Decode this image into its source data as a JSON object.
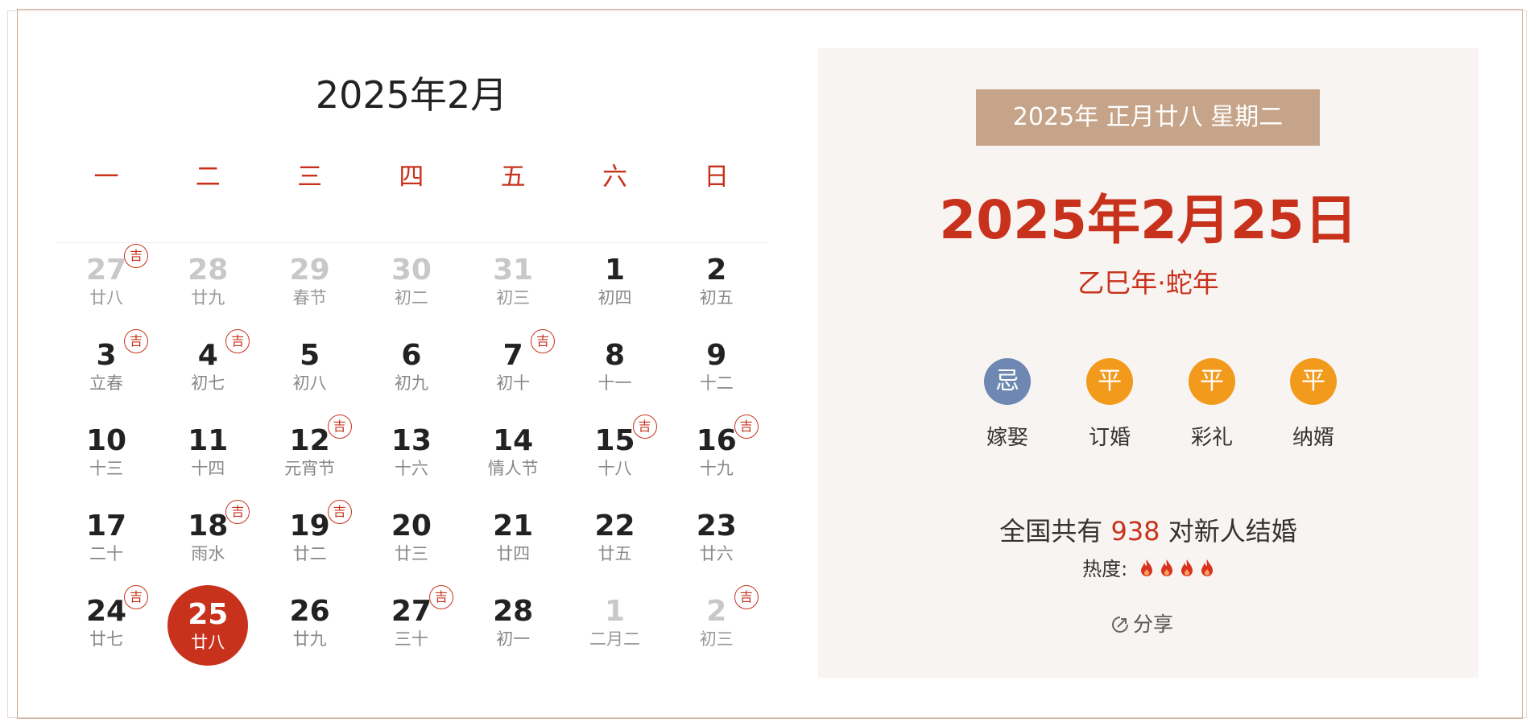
{
  "calendar": {
    "title": "2025年2月",
    "weekdays": [
      "一",
      "二",
      "三",
      "四",
      "五",
      "六",
      "日"
    ],
    "ji_label": "吉",
    "days": [
      {
        "num": "27",
        "lunar": "廿八",
        "other": true,
        "ji": true
      },
      {
        "num": "28",
        "lunar": "廿九",
        "other": true,
        "ji": false
      },
      {
        "num": "29",
        "lunar": "春节",
        "other": true,
        "ji": false
      },
      {
        "num": "30",
        "lunar": "初二",
        "other": true,
        "ji": false
      },
      {
        "num": "31",
        "lunar": "初三",
        "other": true,
        "ji": false
      },
      {
        "num": "1",
        "lunar": "初四",
        "other": false,
        "ji": false
      },
      {
        "num": "2",
        "lunar": "初五",
        "other": false,
        "ji": false
      },
      {
        "num": "3",
        "lunar": "立春",
        "other": false,
        "ji": true
      },
      {
        "num": "4",
        "lunar": "初七",
        "other": false,
        "ji": true
      },
      {
        "num": "5",
        "lunar": "初八",
        "other": false,
        "ji": false
      },
      {
        "num": "6",
        "lunar": "初九",
        "other": false,
        "ji": false
      },
      {
        "num": "7",
        "lunar": "初十",
        "other": false,
        "ji": true
      },
      {
        "num": "8",
        "lunar": "十一",
        "other": false,
        "ji": false
      },
      {
        "num": "9",
        "lunar": "十二",
        "other": false,
        "ji": false
      },
      {
        "num": "10",
        "lunar": "十三",
        "other": false,
        "ji": false
      },
      {
        "num": "11",
        "lunar": "十四",
        "other": false,
        "ji": false
      },
      {
        "num": "12",
        "lunar": "元宵节",
        "other": false,
        "ji": true
      },
      {
        "num": "13",
        "lunar": "十六",
        "other": false,
        "ji": false
      },
      {
        "num": "14",
        "lunar": "情人节",
        "other": false,
        "ji": false
      },
      {
        "num": "15",
        "lunar": "十八",
        "other": false,
        "ji": true
      },
      {
        "num": "16",
        "lunar": "十九",
        "other": false,
        "ji": true
      },
      {
        "num": "17",
        "lunar": "二十",
        "other": false,
        "ji": false
      },
      {
        "num": "18",
        "lunar": "雨水",
        "other": false,
        "ji": true
      },
      {
        "num": "19",
        "lunar": "廿二",
        "other": false,
        "ji": true
      },
      {
        "num": "20",
        "lunar": "廿三",
        "other": false,
        "ji": false
      },
      {
        "num": "21",
        "lunar": "廿四",
        "other": false,
        "ji": false
      },
      {
        "num": "22",
        "lunar": "廿五",
        "other": false,
        "ji": false
      },
      {
        "num": "23",
        "lunar": "廿六",
        "other": false,
        "ji": false
      },
      {
        "num": "24",
        "lunar": "廿七",
        "other": false,
        "ji": true
      },
      {
        "num": "25",
        "lunar": "廿八",
        "other": false,
        "ji": false,
        "selected": true
      },
      {
        "num": "26",
        "lunar": "廿九",
        "other": false,
        "ji": false
      },
      {
        "num": "27",
        "lunar": "三十",
        "other": false,
        "ji": true
      },
      {
        "num": "28",
        "lunar": "初一",
        "other": false,
        "ji": false
      },
      {
        "num": "1",
        "lunar": "二月二",
        "other": true,
        "ji": false
      },
      {
        "num": "2",
        "lunar": "初三",
        "other": true,
        "ji": true
      }
    ]
  },
  "info": {
    "lunar_bar": "2025年  正月廿八  星期二",
    "big_date": "2025年2月25日",
    "ganzhi": "乙巳年·蛇年",
    "items": [
      {
        "badge": "忌",
        "label": "嫁娶",
        "color": "#6f88b3"
      },
      {
        "badge": "平",
        "label": "订婚",
        "color": "#f29a1c"
      },
      {
        "badge": "平",
        "label": "彩礼",
        "color": "#f29a1c"
      },
      {
        "badge": "平",
        "label": "纳婿",
        "color": "#f29a1c"
      }
    ],
    "stats_prefix": "全国共有",
    "stats_count": "938",
    "stats_suffix": "对新人结婚",
    "heat_label": "热度:",
    "heat_level": 4,
    "flame_color": "#d9331f",
    "share_label": "分享"
  },
  "colors": {
    "accent": "#c8321c",
    "panel_bg": "#f8f4f1",
    "lunar_bar_bg": "#c5a489"
  }
}
